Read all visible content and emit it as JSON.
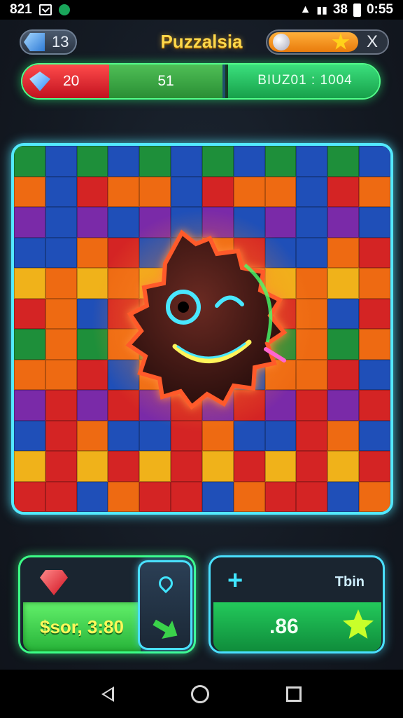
{
  "status_bar": {
    "left_text": "821",
    "right_text": "38",
    "time": "0:55"
  },
  "header": {
    "level_value": "13",
    "title": "Puzzalsia",
    "close_label": "X"
  },
  "stats": {
    "gems": "20",
    "middle_value": "51",
    "right_text": "BIUZ01 : 1004"
  },
  "board": {
    "colors": [
      "#1e8f3a",
      "#d42424",
      "#f0b21a",
      "#1f4fb8",
      "#7a2aa8",
      "#ee6a12"
    ],
    "mascot_icon": "smiling-gear-mascot-icon"
  },
  "bottom_left": {
    "score_text": "$sor, 3:80"
  },
  "bottom_right": {
    "label": "Tbin",
    "value": ".86"
  },
  "icons": {
    "gem": "diamond-icon",
    "ruby": "ruby-icon",
    "pin": "location-pin-icon",
    "arrow": "arrow-icon",
    "plus": "plus-icon",
    "star": "star-icon"
  }
}
